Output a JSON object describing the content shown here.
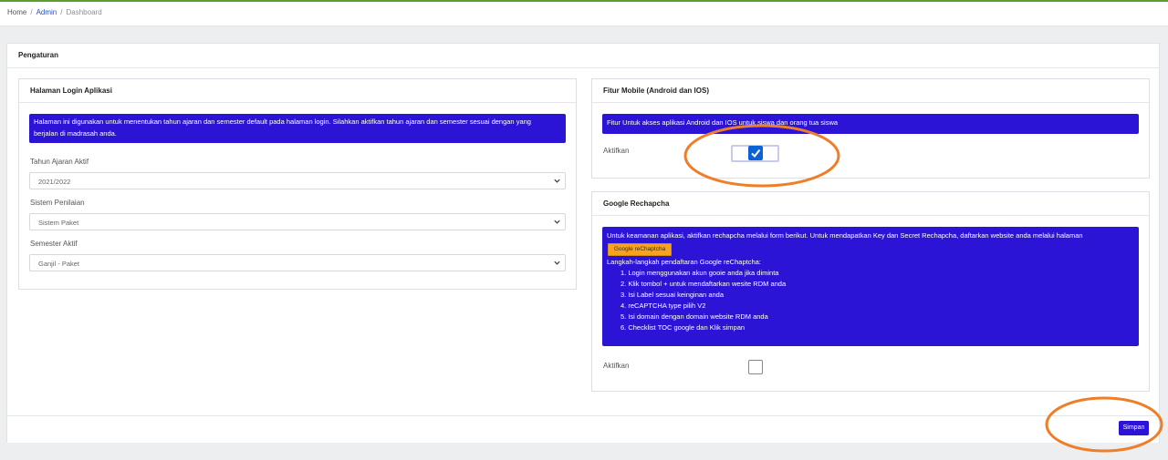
{
  "breadcrumb": {
    "home": "Home",
    "sep": "/",
    "admin": "Admin",
    "current": "Dashboard"
  },
  "card": {
    "title": "Pengaturan",
    "save_label": "Simpan"
  },
  "login_panel": {
    "title": "Halaman Login Aplikasi",
    "info_line1": "Halaman ini digunakan untuk menentukan tahun ajaran dan semester default pada halaman login. Silahkan aktifkan tahun ajaran dan semester sesuai dengan yang",
    "info_line2": "berjalan di madrasah anda.",
    "year_label": "Tahun Ajaran Aktif",
    "year_value": "2021/2022",
    "grading_label": "Sistem Penilaian",
    "grading_value": "Sistem Paket",
    "semester_label": "Semester Aktif",
    "semester_value": "Ganjil - Paket"
  },
  "mobile_panel": {
    "title": "Fitur Mobile (Android dan IOS)",
    "info": "Fitur Untuk akses aplikasi Android dan IOS untuk siswa dan orang tua siswa",
    "activate_label": "Aktifkan",
    "activated": true
  },
  "recaptcha_panel": {
    "title": "Google Rechapcha",
    "info_line1": "Untuk keamanan aplikasi, aktifkan rechapcha melalui form berikut. Untuk mendapatkan Key dan Secret Rechapcha, daftarkan website anda melalui halaman",
    "button_label": "Google reChaptcha",
    "steps_title": "Langkah-langkah pendaftaran Google reChaptcha:",
    "steps": [
      "1. Login menggunakan akun gooie anda jika diminta",
      "2. Klik tombol + untuk mendaftarkan wesite RDM anda",
      "3. Isi Label sesuai keinginan anda",
      "4. reCAPTCHA type pilih V2",
      "5. Isi domain dengan domain website RDM anda",
      "6. Checklist TOC google dan Klik simpan"
    ],
    "activate_label": "Aktifkan",
    "activated": false
  },
  "colors": {
    "accent": "#2b14d6",
    "annotation": "#f07d28",
    "topline": "#5a9f2a"
  }
}
